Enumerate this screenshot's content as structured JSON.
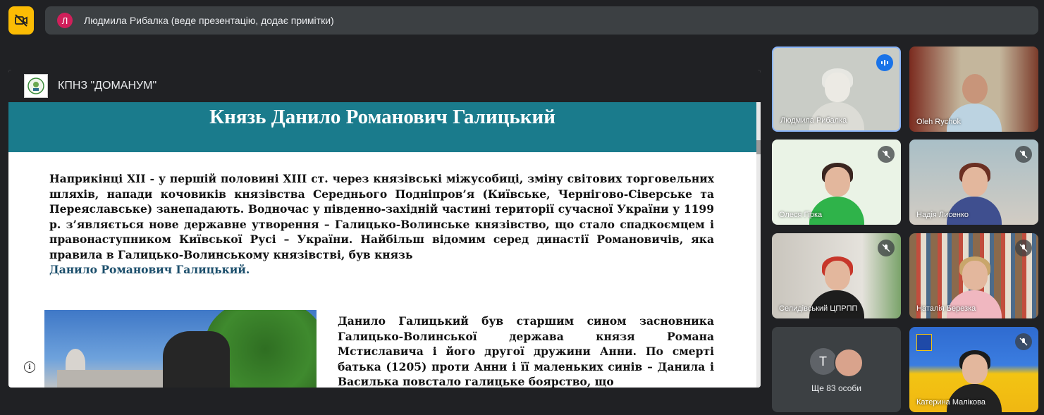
{
  "toolbar": {
    "camera_icon": "camera-off-icon",
    "accent": "#fbbc04"
  },
  "presenter": {
    "initial": "Л",
    "text": "Людмила Рибалка (веде презентацію, додає примітки)"
  },
  "presentation": {
    "window_title": "КПНЗ \"ДОМАНУМ\"",
    "slide_title": "Князь Данило Романович Галицький",
    "paragraph1": "Наприкінці XII - у першій половині XIII ст. через князівські міжусобиці, зміну світових торговельних шляхів, напади кочовиків князівства Середнього Подніпров’я (Київське, Чернігово-Сіверське та Переяславське) занепадають. Водночас у південно-західній частині території сучасної України у 1199 р. з’являється нове державне утворення – Галицько-Волинське князівство, що стало спадкоємцем і правонаступником Київської Русі – України. Найбільш відомим серед династії Романовичів, яка правила в Галицько-Волинському князівстві, був князь",
    "paragraph1_highlight": "Данило Романович Галицький.",
    "paragraph2": "Данило Галицький був старшим сином засновника Галицько-Волинської держава князя Романа Мстиславича і його другої дружини Анни. По смерті батька (1205) проти Анни і її маленьких синів – Данила і Василька повстало галицьке боярство, що",
    "header_color": "#1a7b8c"
  },
  "participants": [
    {
      "name": "Людмила Рибалка",
      "status": "speaking"
    },
    {
      "name": "Oleh Rychok",
      "status": ""
    },
    {
      "name": "Олеся Гірка",
      "status": "muted"
    },
    {
      "name": "Надія Лисенко",
      "status": "muted"
    },
    {
      "name": "Селидівський ЦПРПП",
      "status": "muted"
    },
    {
      "name": "Наталія Березка",
      "status": "muted"
    },
    {
      "name": "Катерина Малікова",
      "status": "muted"
    }
  ],
  "more": {
    "initial": "Т",
    "label": "Ще 83 особи"
  }
}
